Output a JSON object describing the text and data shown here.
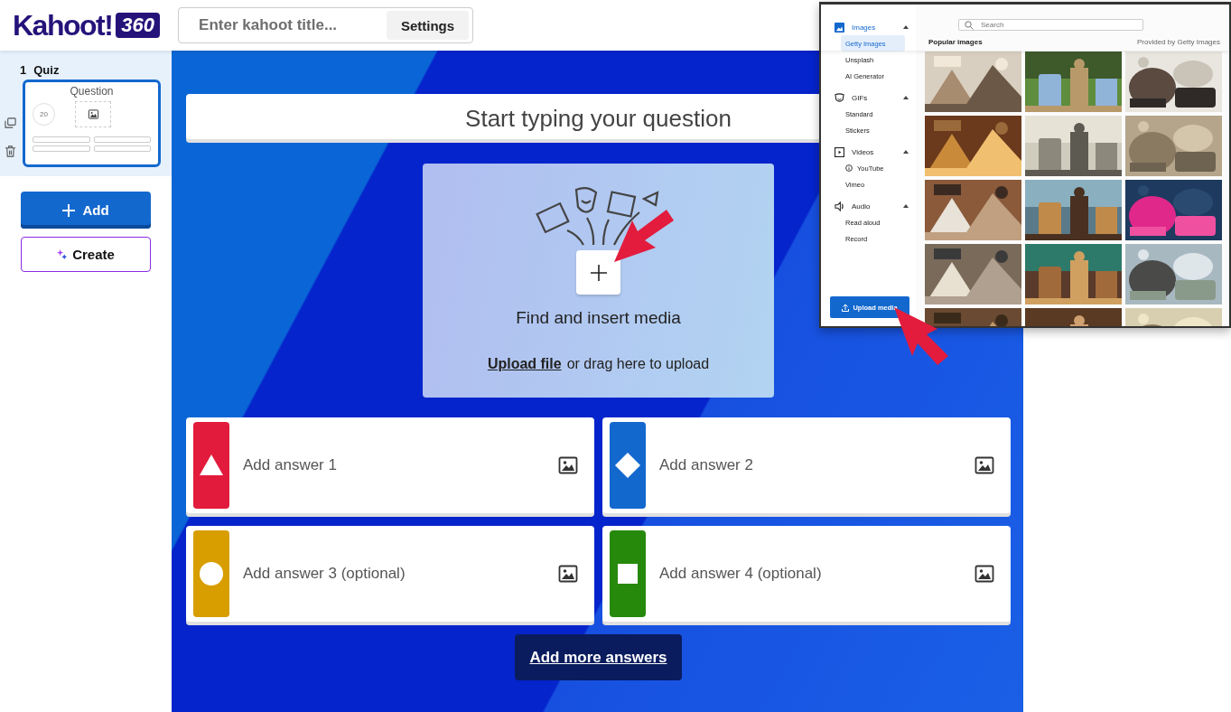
{
  "logo": {
    "name": "Kahoot!",
    "badge": "360"
  },
  "title_bar": {
    "placeholder": "Enter kahoot title...",
    "settings": "Settings"
  },
  "slides": [
    {
      "number": "1",
      "type": "Quiz",
      "label": "Question",
      "timer": "20",
      "selected": true
    }
  ],
  "sidebar_buttons": {
    "add": "Add",
    "create": "Create"
  },
  "question": {
    "placeholder": "Start typing your question"
  },
  "media": {
    "caption": "Find and insert media",
    "upload_link": "Upload file",
    "upload_text": "or drag here to upload"
  },
  "answers": [
    {
      "kind": "triangle",
      "color": "#e21b3c",
      "placeholder": "Add answer 1"
    },
    {
      "kind": "diamond",
      "color": "#1368ce",
      "placeholder": "Add answer 2"
    },
    {
      "kind": "circle",
      "color": "#d89e00",
      "placeholder": "Add answer 3 (optional)"
    },
    {
      "kind": "square",
      "color": "#26890c",
      "placeholder": "Add answer 4 (optional)"
    }
  ],
  "more_answers": "Add more answers",
  "media_popup": {
    "nav": [
      {
        "kind": "images",
        "label": "Images",
        "expanded": true,
        "children": [
          {
            "label": "Getty Images",
            "selected": true,
            "info": false
          },
          {
            "label": "Unsplash",
            "selected": false,
            "info": false
          },
          {
            "label": "AI Generator",
            "selected": false,
            "info": false
          }
        ]
      },
      {
        "kind": "gifs",
        "label": "GIFs",
        "expanded": true,
        "children": [
          {
            "label": "Standard",
            "selected": false,
            "info": false
          },
          {
            "label": "Stickers",
            "selected": false,
            "info": false
          }
        ]
      },
      {
        "kind": "videos",
        "label": "Videos",
        "expanded": true,
        "children": [
          {
            "label": "YouTube",
            "selected": false,
            "info": true
          },
          {
            "label": "Vimeo",
            "selected": false,
            "info": false
          }
        ]
      },
      {
        "kind": "audio",
        "label": "Audio",
        "expanded": true,
        "children": [
          {
            "label": "Read aloud",
            "selected": false,
            "info": false
          },
          {
            "label": "Record",
            "selected": false,
            "info": false
          }
        ]
      }
    ],
    "upload": "Upload media",
    "search": {
      "placeholder": "Search"
    },
    "section_title": "Popular images",
    "provider": "Provided by Getty Images"
  }
}
